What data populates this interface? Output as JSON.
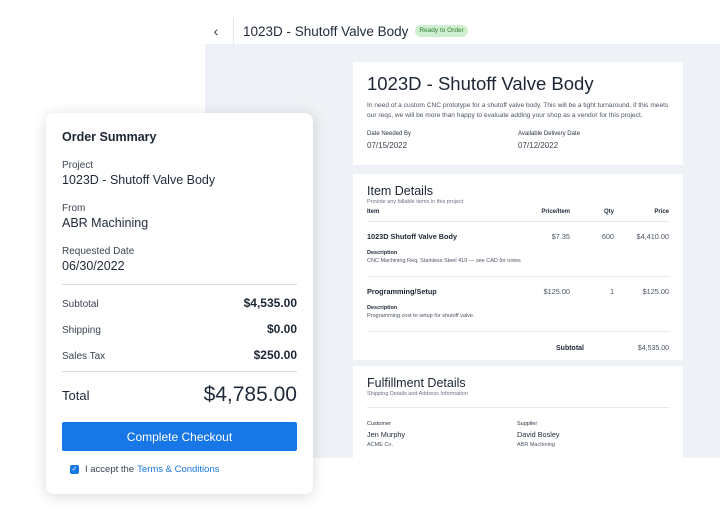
{
  "header": {
    "back_glyph": "‹",
    "title": "1023D - Shutoff Valve Body",
    "status": "Ready to Order",
    "status_color": "#cfeecf"
  },
  "project": {
    "heading": "1023D - Shutoff Valve Body",
    "description": "In need of a custom CNC prototype for a shutoff valve body. This will be a tight turnaround, if this meets our reqs, we will be more than happy to evaluate adding your shop as a vendor for this project.",
    "date_needed_label": "Date Needed By",
    "date_needed": "07/15/2022",
    "delivery_label": "Available Delivery Date",
    "delivery_date": "07/12/2022"
  },
  "items": {
    "title": "Item Details",
    "subtitle": "Provide any billable items in this project",
    "columns": {
      "item": "Item",
      "price": "Price/Item",
      "qty": "Qty",
      "total": "Price"
    },
    "rows": [
      {
        "name": "1023D Shutoff Valve Body",
        "price": "$7.35",
        "qty": "600",
        "total": "$4,410.00",
        "desc_label": "Description",
        "desc": "CNC Machining Req, Stainless Steel 410 — see CAD for notes"
      },
      {
        "name": "Programming/Setup",
        "price": "$125.00",
        "qty": "1",
        "total": "$125.00",
        "desc_label": "Description",
        "desc": "Programming cost to setup for shutoff valve."
      }
    ],
    "subtotal_label": "Subtotal",
    "subtotal": "$4,535.00"
  },
  "fulfillment": {
    "title": "Fulfillment Details",
    "subtitle": "Shipping Details and Address Information",
    "customer_label": "Customer",
    "customer_name": "Jen Murphy",
    "customer_org": "ACME Co.",
    "supplier_label": "Supplier",
    "supplier_name": "David Bosley",
    "supplier_org": "ABR Machining"
  },
  "summary": {
    "title": "Order Summary",
    "project_label": "Project",
    "project": "1023D - Shutoff Valve Body",
    "from_label": "From",
    "from": "ABR Machining",
    "date_label": "Requested Date",
    "date": "06/30/2022",
    "subtotal_label": "Subtotal",
    "subtotal": "$4,535.00",
    "shipping_label": "Shipping",
    "shipping": "$0.00",
    "tax_label": "Sales Tax",
    "tax": "$250.00",
    "total_label": "Total",
    "total": "$4,785.00",
    "checkout_label": "Complete Checkout",
    "accept_text": "I accept the",
    "terms_link": "Terms & Conditions",
    "accent_color": "#1877e6"
  }
}
